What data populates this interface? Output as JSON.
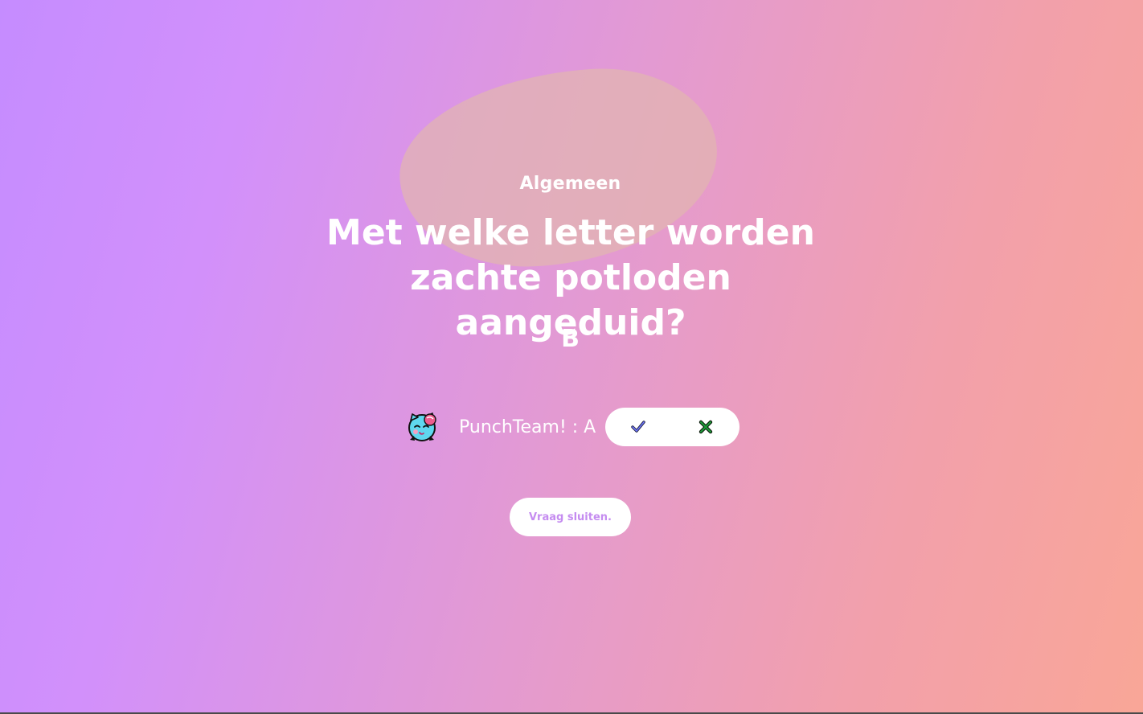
{
  "question": {
    "category": "Algemeen",
    "text": "Met welke letter worden zachte potloden aangeduid?",
    "correct_answer": "B"
  },
  "submission": {
    "team_label": "PunchTeam! : A",
    "avatar_icon": "cat-face-avatar-icon",
    "correct_icon": "checkmark-icon",
    "wrong_icon": "cross-icon"
  },
  "actions": {
    "close_label": "Vraag sluiten."
  },
  "colors": {
    "gradient_start": "#c58cff",
    "gradient_end": "#f9a697",
    "button_text": "#c58cf0"
  }
}
